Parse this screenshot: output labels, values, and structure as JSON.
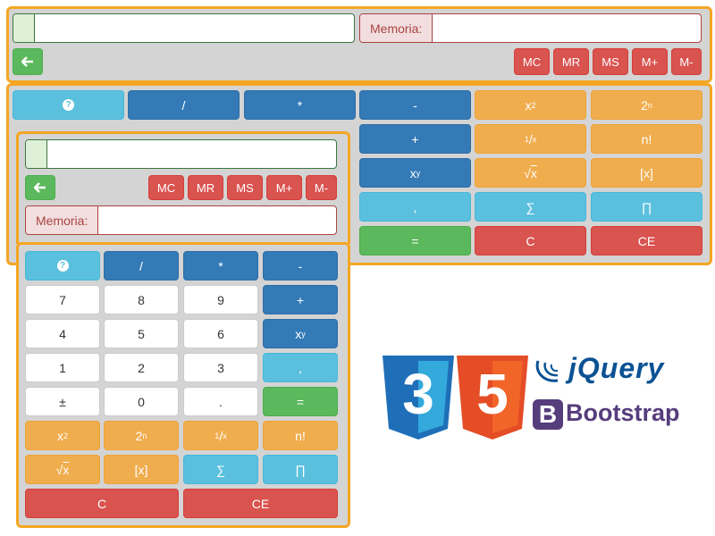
{
  "large": {
    "display_value": "",
    "memory_label": "Memoria:",
    "memory_value": "",
    "back_icon": "arrow-left-icon",
    "mem_buttons": [
      "MC",
      "MR",
      "MS",
      "M+",
      "M-"
    ],
    "keys": {
      "help_icon": "question-icon",
      "divide": "/",
      "multiply": "*",
      "minus": "-",
      "x_sq_base": "x",
      "x_sq_exp": "2",
      "two_n_base": "2",
      "two_n_exp": "n",
      "plus": "+",
      "recip_num": "1",
      "recip_slash": "/",
      "recip_den": "x",
      "fact": "n!",
      "pow_base": "x",
      "pow_exp": "y",
      "sqrt_sym": "√",
      "sqrt_arg": "x",
      "abs": "[x]",
      "comma": ",",
      "sum": "∑",
      "prod": "∏",
      "equals": "=",
      "c": "C",
      "ce": "CE"
    }
  },
  "small": {
    "display_value": "",
    "memory_label": "Memoria:",
    "memory_value": "",
    "mem_buttons": [
      "MC",
      "MR",
      "MS",
      "M+",
      "M-"
    ],
    "keys": {
      "divide": "/",
      "multiply": "*",
      "minus": "-",
      "d7": "7",
      "d8": "8",
      "d9": "9",
      "plus": "+",
      "d4": "4",
      "d5": "5",
      "d6": "6",
      "pow_base": "x",
      "pow_exp": "y",
      "d1": "1",
      "d2": "2",
      "d3": "3",
      "comma": ",",
      "pm": "±",
      "d0": "0",
      "dot": ".",
      "equals": "=",
      "x_sq_base": "x",
      "x_sq_exp": "2",
      "two_n_base": "2",
      "two_n_exp": "n",
      "recip_num": "1",
      "recip_slash": "/",
      "recip_den": "x",
      "fact": "n!",
      "sqrt_sym": "√",
      "sqrt_arg": "x",
      "abs": "[x]",
      "sum": "∑",
      "prod": "∏",
      "c": "C",
      "ce": "CE"
    }
  },
  "logos": {
    "css3_digit": "3",
    "html5_digit": "5",
    "jquery": "jQuery",
    "bootstrap_letter": "B",
    "bootstrap": "Bootstrap"
  },
  "colors": {
    "accent_border": "#f5a623",
    "panel_bg": "#d4d4d4",
    "info": "#5bc0de",
    "primary": "#337ab7",
    "warning": "#f0ad4e",
    "danger": "#d9534f",
    "success": "#5cb85c",
    "css3_blue": "#1f6fb8",
    "html5_orange": "#e44d26",
    "jquery_blue": "#0b5294",
    "bootstrap_purple": "#563d7c"
  }
}
